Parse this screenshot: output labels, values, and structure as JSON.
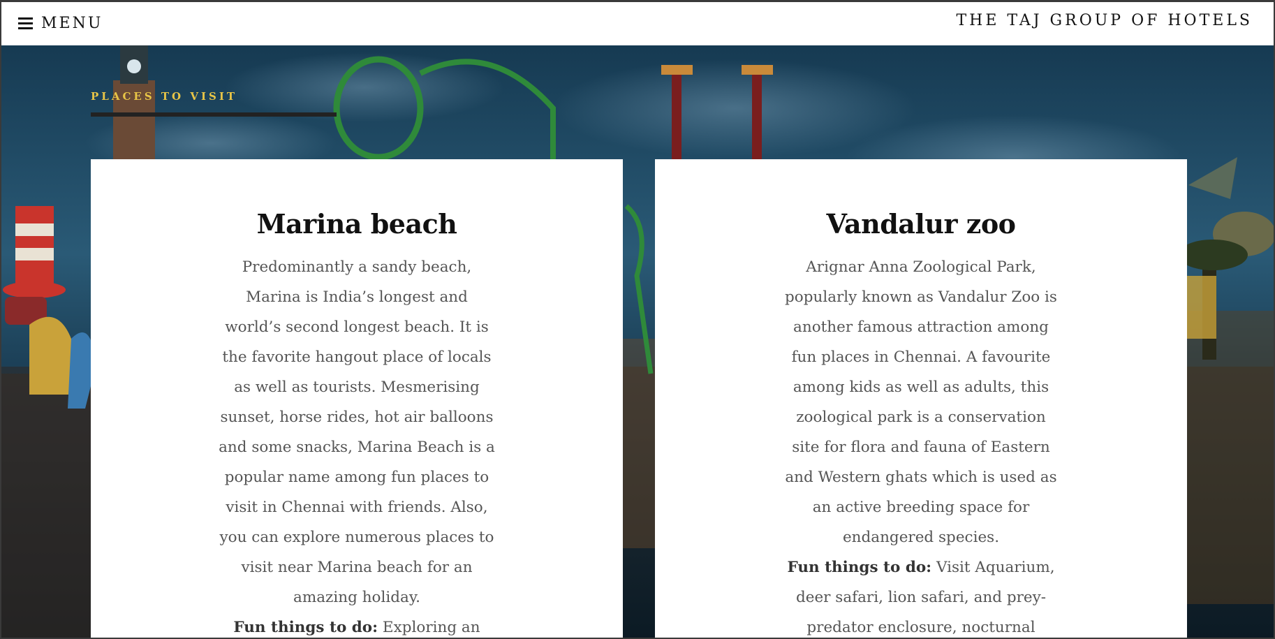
{
  "header": {
    "menu_label": "MENU",
    "brand": "THE TAJ GROUP OF HOTELS"
  },
  "section": {
    "label": "PLACES TO VISIT"
  },
  "cards": [
    {
      "title": "Marina beach",
      "description": "Predominantly a sandy beach, Marina is India’s longest and world’s second longest beach. It is the favorite hangout place of locals as well as tourists. Mesmerising sunset, horse rides, hot air balloons and some snacks, Marina Beach is a popular name among fun places to visit in Chennai with friends. Also, you can explore numerous places to visit near Marina beach for an amazing holiday.",
      "fun_label": "Fun things to do:",
      "fun_text": " Exploring an"
    },
    {
      "title": "Vandalur zoo",
      "description": "Arignar Anna Zoological Park, popularly known as Vandalur Zoo is another famous attraction among fun places in Chennai. A favourite among kids as well as adults, this zoological park is a conservation site for flora and fauna of Eastern and Western ghats which is used as an active breeding space for endangered species.",
      "fun_label": "Fun things to do:",
      "fun_text": " Visit Aquarium, deer safari, lion safari, and prey-predator enclosure, nocturnal"
    }
  ],
  "colors": {
    "accent": "#e8c547",
    "header_bg": "#ffffff",
    "card_bg": "#ffffff",
    "hero_sky": "#1e4a66"
  },
  "icons": {
    "menu": "hamburger-icon"
  }
}
